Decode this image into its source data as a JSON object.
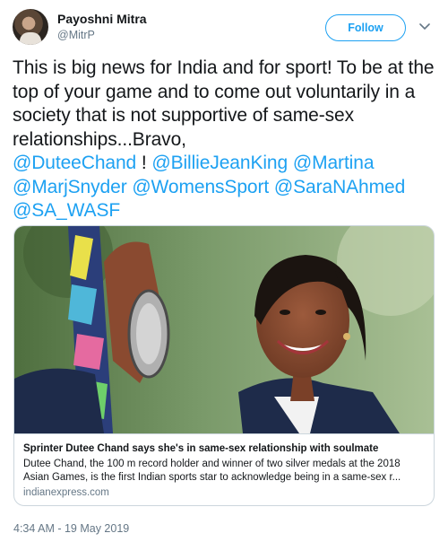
{
  "author": {
    "name": "Payoshni Mitra",
    "handle": "@MitrP",
    "follow_label": "Follow"
  },
  "tweet": {
    "text_plain": "This is big news for India and for sport! To be at the top of your game and to come out voluntarily in a society that is not supportive of same-sex relationships...Bravo,",
    "mentions": [
      "@DuteeChand",
      "@BillieJeanKing",
      "@Martina",
      "@MarjSnyder",
      "@WomensSport",
      "@SaraNAhmed",
      "@SA_WASF"
    ],
    "separator_after_first": " ! "
  },
  "card": {
    "title": "Sprinter Dutee Chand says she's in same-sex relationship with soulmate",
    "description": "Dutee Chand, the 100 m record holder and winner of two silver medals at the 2018 Asian Games, is the first Indian sports star to acknowledge being in a same-sex r...",
    "domain": "indianexpress.com"
  },
  "timestamp": "4:34 AM - 19 May 2019",
  "icons": {
    "chevron": "chevron-down-icon"
  },
  "colors": {
    "accent": "#1da1f2",
    "text": "#14171a",
    "muted": "#657786",
    "border": "#ccd6dd"
  }
}
